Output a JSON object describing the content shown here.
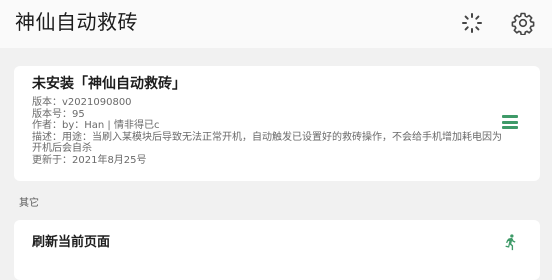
{
  "appbar": {
    "title": "神仙自动救砖",
    "loading_icon": "loading-spinner-icon",
    "settings_icon": "gear-icon"
  },
  "module": {
    "title": "未安装「神仙自动救砖」",
    "version": "版本：v2021090800",
    "version_code": "版本号：95",
    "author": "作者：by：Han | 情非得已c",
    "description": "描述：用途：当刷入某模块后导致无法正常开机，自动触发已设置好的救砖操作，不会给手机增加耗电因为开机后会自杀",
    "updated": "更新于：2021年8月25号",
    "menu_icon": "menu-icon"
  },
  "other_section": {
    "label": "其它",
    "actions": [
      {
        "label": "刷新当前页面",
        "icon": "running-person-icon"
      }
    ]
  },
  "colors": {
    "accent": "#3e9a68",
    "background": "#f1f1f1",
    "card": "#ffffff",
    "appbar": "#fafafa"
  }
}
